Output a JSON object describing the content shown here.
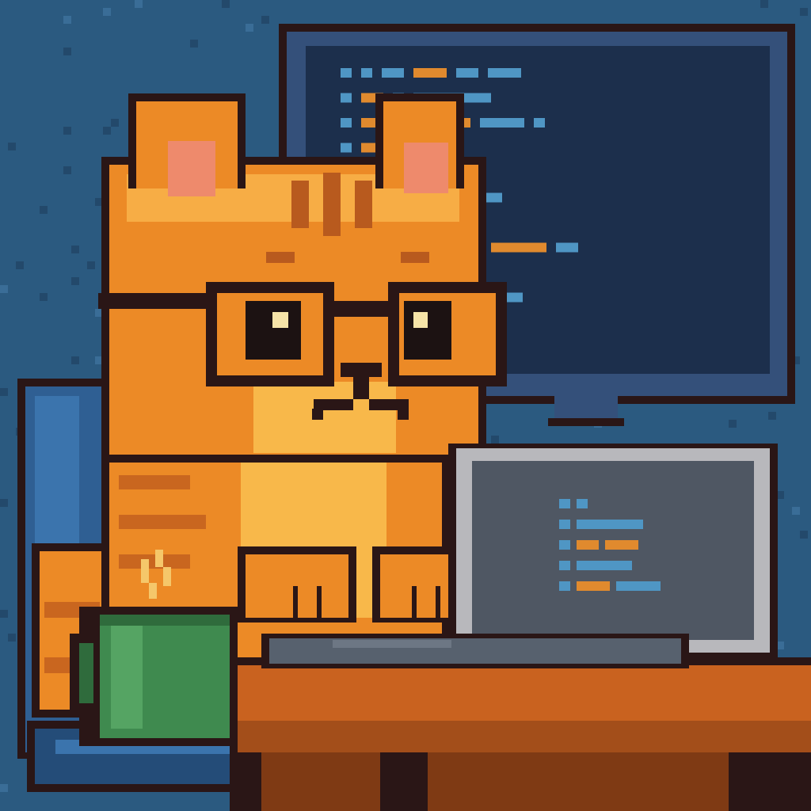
{
  "scene": {
    "subject": "cat-icon",
    "accessories": [
      "glasses-icon",
      "laptop-icon",
      "coffee-mug-icon",
      "monitor-icon",
      "desk-chair-icon",
      "desk-icon"
    ],
    "steam": "steam-icon"
  },
  "palette": {
    "outline": "#2a1616",
    "background": "#2b5a80",
    "background_dark": "#23496b",
    "background_light": "#3a6d97",
    "fur": "#ec8a26",
    "fur_light": "#f7ad45",
    "fur_dark": "#c9661f",
    "fur_stripe": "#b85a1e",
    "fur_chest": "#f8b84a",
    "ear_inner": "#ee8a6c",
    "eye": "#1c1212",
    "eye_shine": "#f6e4a8",
    "glasses": "#2a1616",
    "monitor_frame": "#34507a",
    "monitor_screen": "#1c2f4c",
    "code_blue": "#4f96c4",
    "code_blue_dark": "#3e78a8",
    "code_orange": "#e08a2e",
    "code_orange_dark": "#c7702a",
    "laptop_frame": "#b8b8bc",
    "laptop_screen": "#4f5763",
    "laptop_base": "#57616e",
    "laptop_base_light": "#6d7784",
    "desk": "#c9621f",
    "desk_dark": "#a34e1a",
    "desk_shadow": "#7f3a14",
    "chair": "#2f5f93",
    "chair_dark": "#244c78",
    "chair_light": "#3b74ad",
    "mug": "#3f8a4f",
    "mug_dark": "#2f6b3c",
    "mug_light": "#55a463",
    "steam": "#f5c76a"
  },
  "code_lines": [
    [
      [
        "b",
        1
      ],
      [
        "b",
        1
      ],
      [
        "b",
        2
      ],
      [
        "o",
        3
      ],
      [
        "b",
        2
      ],
      [
        "b",
        3
      ]
    ],
    [
      [
        "b",
        1
      ],
      [
        "o",
        2
      ],
      [
        "b",
        1
      ],
      [
        "b",
        7
      ]
    ],
    [
      [
        "b",
        1
      ],
      [
        "o",
        4
      ],
      [
        "o",
        5
      ],
      [
        "b",
        4
      ],
      [
        "b",
        1
      ]
    ],
    [
      [
        "b",
        1
      ],
      [
        "o",
        3
      ],
      [
        "b",
        4
      ]
    ],
    [
      [
        "b",
        1
      ],
      [
        "o",
        3
      ],
      [
        "b",
        2
      ],
      [
        "b",
        4
      ]
    ],
    [
      [
        "b",
        1
      ],
      [
        "o",
        4
      ],
      [
        "b",
        2
      ],
      [
        "b",
        5
      ]
    ],
    [
      [
        "b",
        1
      ],
      [
        "b",
        1
      ],
      [
        "o",
        4
      ]
    ],
    [
      [
        "b",
        1
      ],
      [
        "b",
        4
      ],
      [
        "o",
        6
      ],
      [
        "o",
        5
      ],
      [
        "b",
        2
      ]
    ],
    [
      [
        "b",
        2
      ],
      [
        "o",
        3
      ],
      [
        "b",
        2
      ]
    ],
    [
      [
        "b",
        1
      ],
      [
        "o",
        4
      ],
      [
        "b",
        2
      ],
      [
        "b",
        3
      ],
      [
        "b",
        3
      ]
    ],
    [
      [
        "b",
        1
      ],
      [
        "o",
        1
      ],
      [
        "o",
        3
      ],
      [
        "b",
        3
      ]
    ],
    [
      [
        "b",
        1
      ],
      [
        "o",
        4
      ],
      [
        "b",
        4
      ]
    ]
  ],
  "laptop_code_lines": [
    [
      [
        "b",
        1
      ],
      [
        "b",
        1
      ]
    ],
    [
      [
        "b",
        1
      ],
      [
        "b",
        6
      ]
    ],
    [
      [
        "b",
        1
      ],
      [
        "o",
        2
      ],
      [
        "o",
        3
      ]
    ],
    [
      [
        "b",
        1
      ],
      [
        "b",
        5
      ]
    ],
    [
      [
        "b",
        1
      ],
      [
        "o",
        3
      ],
      [
        "b",
        4
      ]
    ]
  ]
}
